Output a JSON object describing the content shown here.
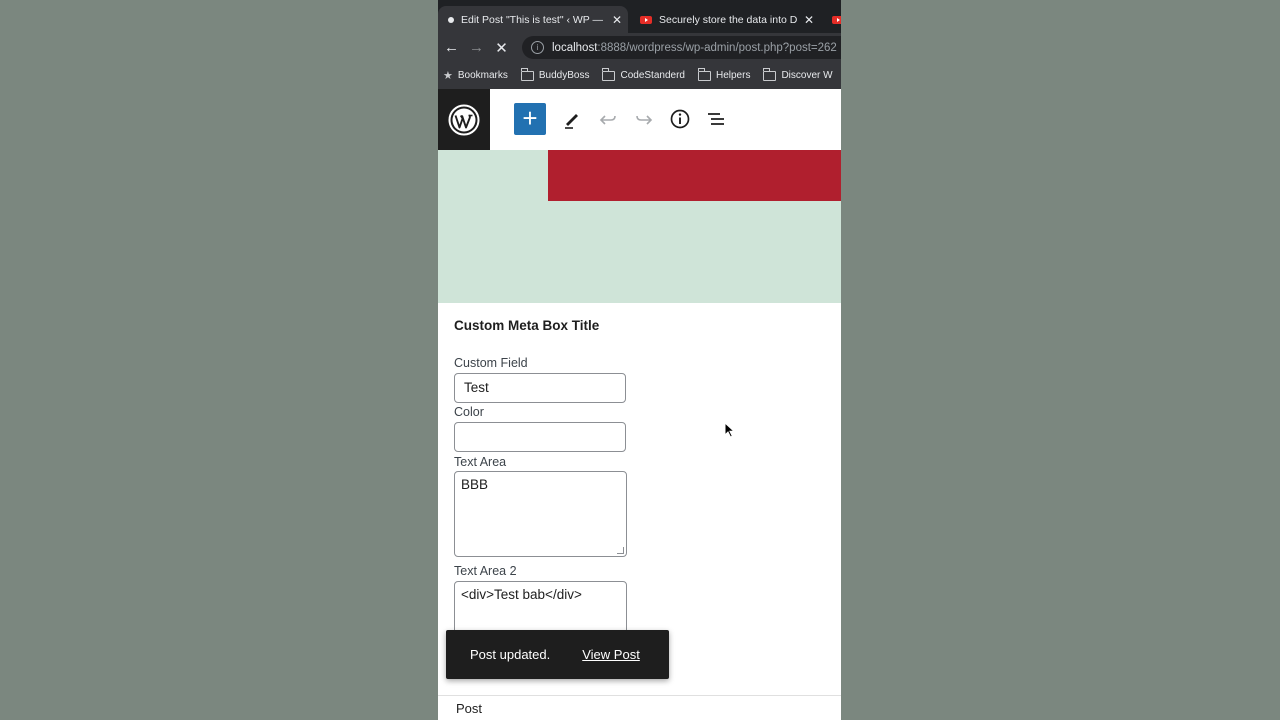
{
  "browser": {
    "tabs": [
      {
        "title": "Edit Post \"This is test\" ‹ WP —",
        "active": true
      },
      {
        "title": "Securely store the data into DB",
        "active": false
      },
      {
        "title": "",
        "active": false
      }
    ],
    "url_host": "localhost",
    "url_rest": ":8888/wordpress/wp-admin/post.php?post=262",
    "bookmarks": [
      "Bookmarks",
      "BuddyBoss",
      "CodeStanderd",
      "Helpers",
      "Discover W"
    ]
  },
  "wp": {
    "add_label": "+",
    "colors": {
      "accent": "#2271b1",
      "red_block": "#b01f2e",
      "canvas": "#cfe4d8"
    }
  },
  "metabox": {
    "title": "Custom Meta Box Title",
    "fields": [
      {
        "label": "Custom Field",
        "value": "Test"
      },
      {
        "label": "Color",
        "value": ""
      },
      {
        "label": "Text Area",
        "value": "BBB"
      },
      {
        "label": "Text Area 2",
        "value": "<div>Test bab</div>"
      }
    ]
  },
  "snackbar": {
    "message": "Post updated.",
    "link": "View Post"
  },
  "footer": {
    "post_label": "Post"
  }
}
